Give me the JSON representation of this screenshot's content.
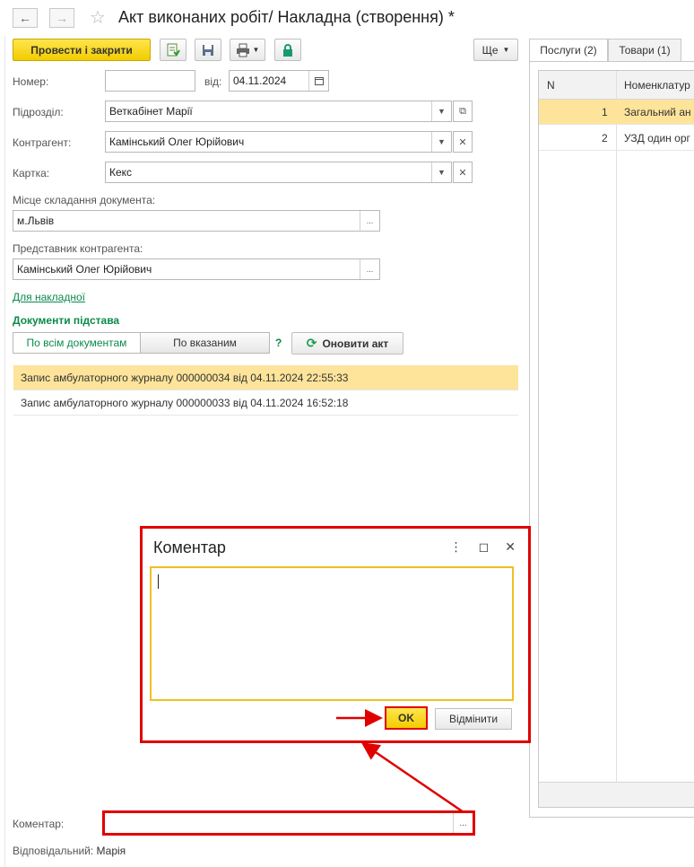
{
  "window": {
    "title": "Акт виконаних робіт/ Накладна (створення) *"
  },
  "toolbar": {
    "post_close": "Провести і закрити",
    "more": "Ще"
  },
  "form": {
    "number_label": "Номер:",
    "number_value": "",
    "date_label": "від:",
    "date_value": "04.11.2024",
    "department_label": "Підрозділ:",
    "department_value": "Веткабінет Марії",
    "counterparty_label": "Контрагент:",
    "counterparty_value": "Камінський Олег Юрійович",
    "card_label": "Картка:",
    "card_value": "Кекс",
    "place_label": "Місце складання документа:",
    "place_value": "м.Львів",
    "rep_label": "Представник контрагента:",
    "rep_value": "Камінський Олег Юрійович",
    "invoice_link": "Для накладної",
    "docs_section": "Документи підстава",
    "all_docs": "По всім документам",
    "selected_docs": "По вказаним",
    "help": "?",
    "update_act": "Оновити акт"
  },
  "base_docs": [
    "Запис амбулаторного журналу 000000034 від 04.11.2024 22:55:33",
    "Запис амбулаторного журналу 000000033 від 04.11.2024 16:52:18"
  ],
  "tabs": [
    {
      "label": "Послуги (2)"
    },
    {
      "label": "Товари (1)"
    }
  ],
  "services_table": {
    "headers": [
      "N",
      "Номенклатур"
    ],
    "rows": [
      {
        "n": "1",
        "name": "Загальний ан"
      },
      {
        "n": "2",
        "name": "УЗД один орг"
      }
    ]
  },
  "dialog": {
    "title": "Коментар",
    "text": "",
    "ok": "OK",
    "cancel": "Відмінити"
  },
  "footer": {
    "comment_label": "Коментар:",
    "comment_value": "",
    "responsible_label": "Відповідальний:",
    "responsible_value": "Марія"
  },
  "colors": {
    "accent_yellow": "#f2cc00",
    "link_green": "#0b8a4b",
    "highlight": "#e00000",
    "selected_row": "#fde49a"
  },
  "icons": [
    "back-arrow-icon",
    "forward-arrow-icon",
    "star-icon",
    "post-document-icon",
    "save-icon",
    "print-icon",
    "lock-icon",
    "calendar-icon",
    "refresh-icon",
    "more-vertical-icon",
    "maximize-icon",
    "close-icon"
  ]
}
